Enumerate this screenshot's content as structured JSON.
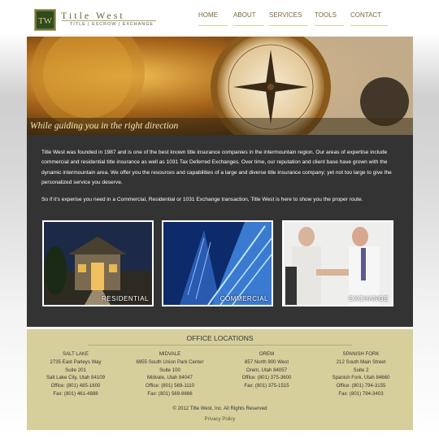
{
  "logo": {
    "title": "Title West",
    "subtitle": "TITLE | ESCROW | EXCHANGE",
    "mark": "TW"
  },
  "nav": [
    {
      "label": "HOME"
    },
    {
      "label": "ABOUT"
    },
    {
      "label": "SERVICES"
    },
    {
      "label": "TOOLS"
    },
    {
      "label": "CONTACT"
    }
  ],
  "hero": {
    "tagline": "While guiding you in the right direction"
  },
  "intro": {
    "p1": "Title West was founded in 1987 and is one of the best known title insurance companies in the intermountain region. Our areas of expertise include commercial and residential title insurance as well as 1031 Tax Deferred Exchanges. Over time, our reputation and client base have grown with the dynamic intermountain area. We offer you the resources and capabilities of a large and diverse title insurance company; yet not too large to give the personalized service you deserve.",
    "p2": "So if it's experise you need in a Commercial, Residential or 1031 Exchange transaction, Title West is here to show you the proper route."
  },
  "tiles": [
    {
      "label": "RESIDENTIAL"
    },
    {
      "label": "COMMERCIAL"
    },
    {
      "label": "EXCHANGE"
    }
  ],
  "offices": {
    "title": "OFFICE LOCATIONS",
    "list": [
      {
        "city": "SALT LAKE",
        "address": "2735 East Parleys Way",
        "suite": "Suite 201",
        "citystate": "Salt Lake City, Utah 84109",
        "office": "Office: (801) 485-1600",
        "fax": "Fax: (801) 461-4888"
      },
      {
        "city": "MIDVALE",
        "address": "6955 South Union Park Center",
        "suite": "Suite 100",
        "citystate": "Midvale, Utah 84047",
        "office": "Office: (801) 569-1110",
        "fax": "Fax: (801) 569-8666"
      },
      {
        "city": "OREM",
        "address": "857 North 900 West",
        "suite": "",
        "citystate": "Orem, Utah 84057",
        "office": "Office: (801) 375-3600",
        "fax": "Fax: (801) 375-1515"
      },
      {
        "city": "SPANISH FORK",
        "address": "212 South Main Street",
        "suite": "Suite 2",
        "citystate": "Spanish Fork, Utah 84660",
        "office": "Office: (801) 794-3155",
        "fax": "Fax: (801) 794-3403"
      }
    ]
  },
  "footer": {
    "copyright": "© 2012 Title West, Inc. All Rights Reserved",
    "privacy": "Privacy Policy"
  }
}
